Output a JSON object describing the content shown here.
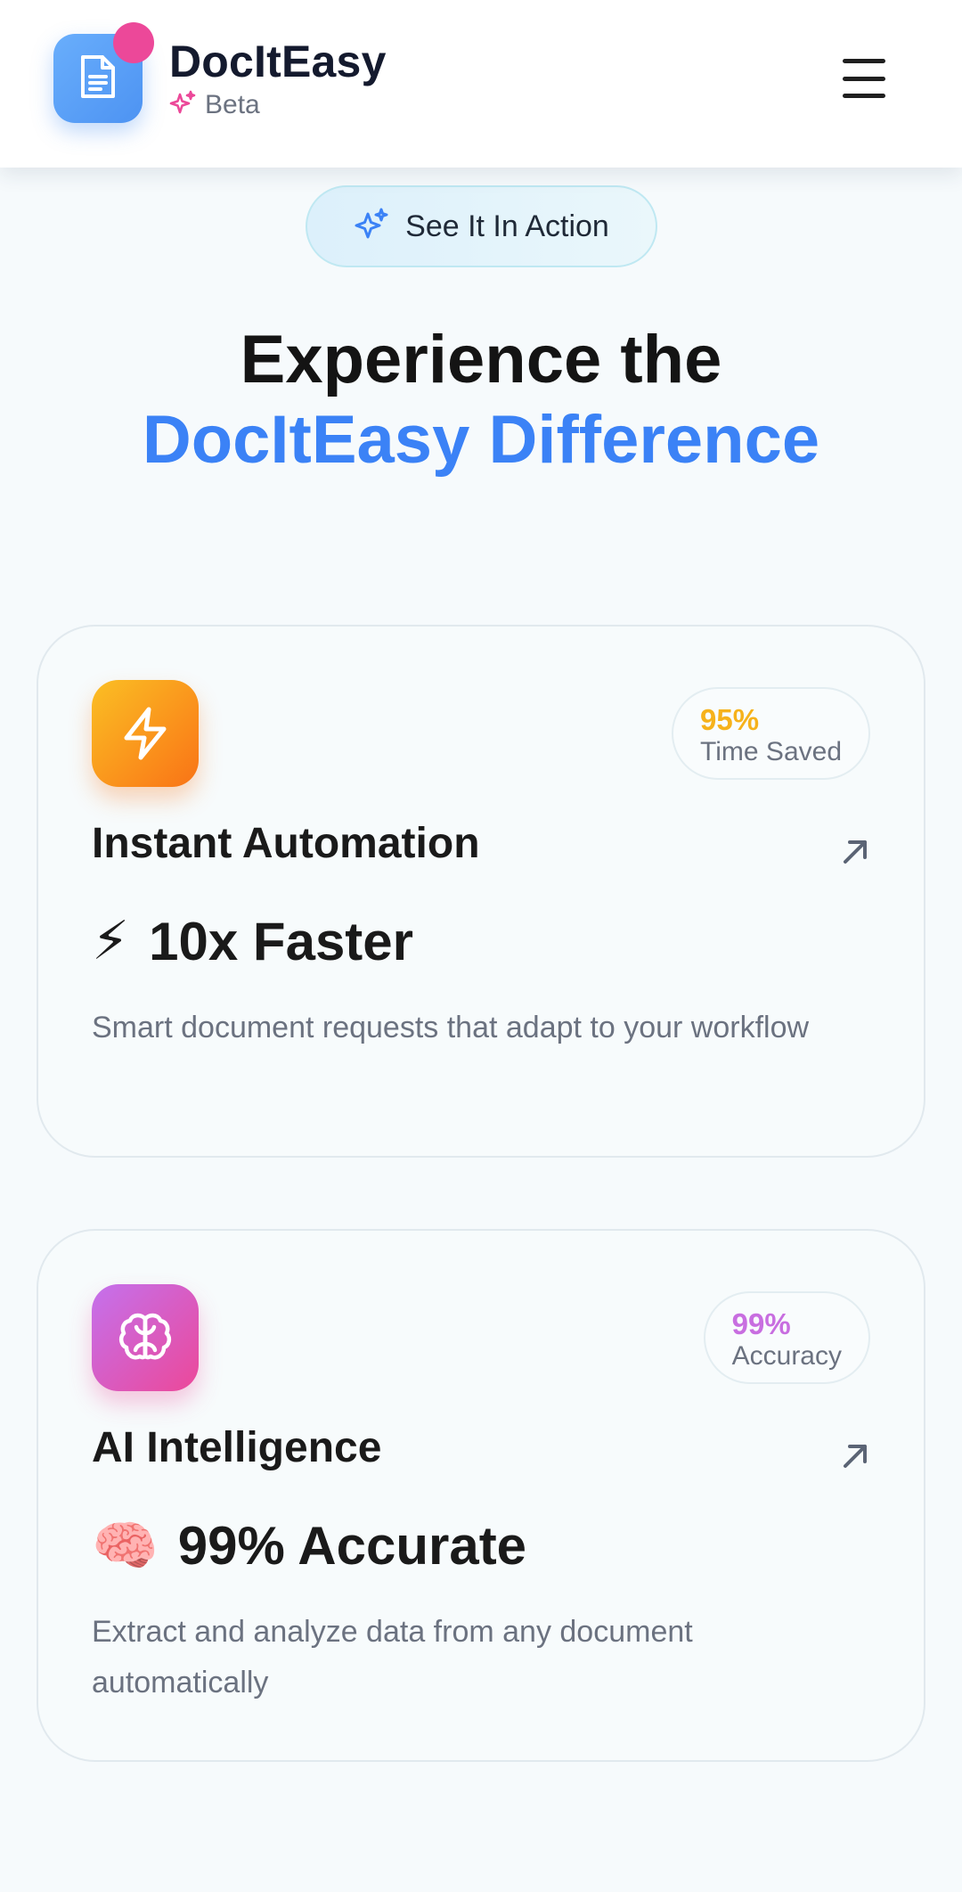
{
  "header": {
    "brand_name": "DocItEasy",
    "brand_tag": "Beta",
    "logo_icon": "document-icon",
    "tag_icon": "sparkles-icon",
    "menu_icon": "hamburger-menu-icon",
    "accent_color": "#4d93f2",
    "notification_color": "#ec4899"
  },
  "hero": {
    "pill_label": "See It In Action",
    "pill_icon": "sparkles-icon",
    "title_line1": "Experience the",
    "title_line2": "DocItEasy Difference",
    "highlight_color": "#3b82f6"
  },
  "features": [
    {
      "icon": "lightning-bolt-icon",
      "badge_value": "95%",
      "badge_label": "Time Saved",
      "badge_color": "#f6b21b",
      "title": "Instant Automation",
      "metric_emoji": "⚡",
      "metric": "10x Faster",
      "description": "Smart document requests that adapt to your workflow",
      "link_icon": "arrow-up-right-icon"
    },
    {
      "icon": "brain-icon",
      "badge_value": "99%",
      "badge_label": "Accuracy",
      "badge_color": "#c86ee0",
      "title": "AI Intelligence",
      "metric_emoji": "🧠",
      "metric": "99% Accurate",
      "description": "Extract and analyze data from any document automatically",
      "link_icon": "arrow-up-right-icon"
    }
  ]
}
